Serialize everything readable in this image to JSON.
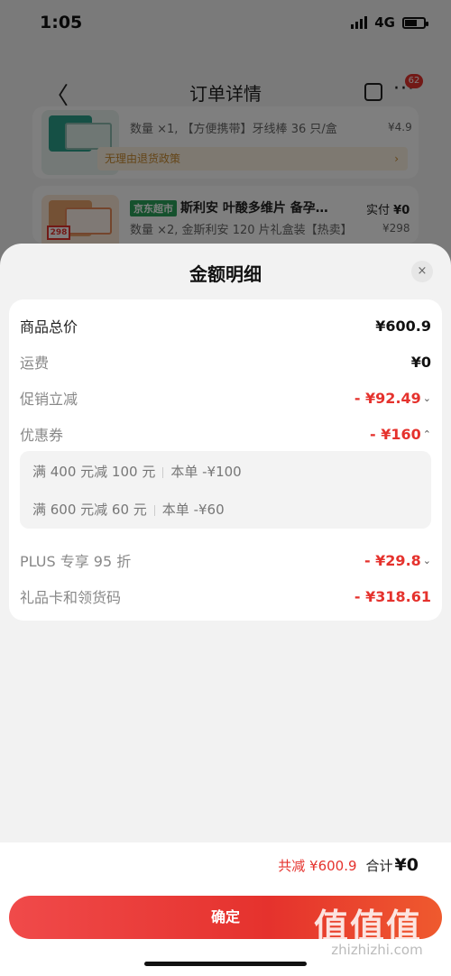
{
  "status": {
    "time": "1:05",
    "network": "4G"
  },
  "nav": {
    "back_glyph": "〈",
    "title": "订单详情",
    "more_glyph": "···",
    "badge": "62"
  },
  "bg_items": [
    {
      "qty_line": "数量 ×1, 【方便携带】牙线棒 36 只/盒",
      "price": "¥4.9",
      "policy": "无理由退货政策"
    },
    {
      "tag": "京东超市",
      "title": "斯利安 叶酸多维片 备孕…",
      "paid_label": "实付",
      "paid_value": "¥0",
      "qty_line": "数量 ×2, 金斯利安 120 片礼盒装【热卖】",
      "price": "¥298",
      "thumb_tag": "298"
    }
  ],
  "sheet": {
    "title": "金额明细",
    "close_glyph": "×",
    "rows": {
      "total": {
        "label": "商品总价",
        "value": "¥600.9"
      },
      "shipping": {
        "label": "运费",
        "value": "¥0"
      },
      "promo": {
        "label": "促销立减",
        "value": "- ¥92.49"
      },
      "coupon": {
        "label": "优惠券",
        "value": "- ¥160"
      },
      "plus": {
        "label": "PLUS 专享 95 折",
        "value": "- ¥29.8"
      },
      "gift": {
        "label": "礼品卡和领货码",
        "value": "- ¥318.61"
      }
    },
    "coupons": [
      {
        "rule": "满 400 元减 100 元",
        "amount": "本单 -¥100"
      },
      {
        "rule": "满 600 元减 60 元",
        "amount": "本单 -¥60"
      }
    ],
    "summary": {
      "reduce": "共减 ¥600.9",
      "total_label": "合计",
      "total_value": "¥0"
    },
    "confirm_label": "确定"
  },
  "watermark": {
    "logo": "值值值",
    "text": "zhizhizhi.com"
  },
  "colors": {
    "accent": "#e5322d",
    "policy_bg": "#fdf3e3",
    "jd_green": "#2aa35a"
  }
}
